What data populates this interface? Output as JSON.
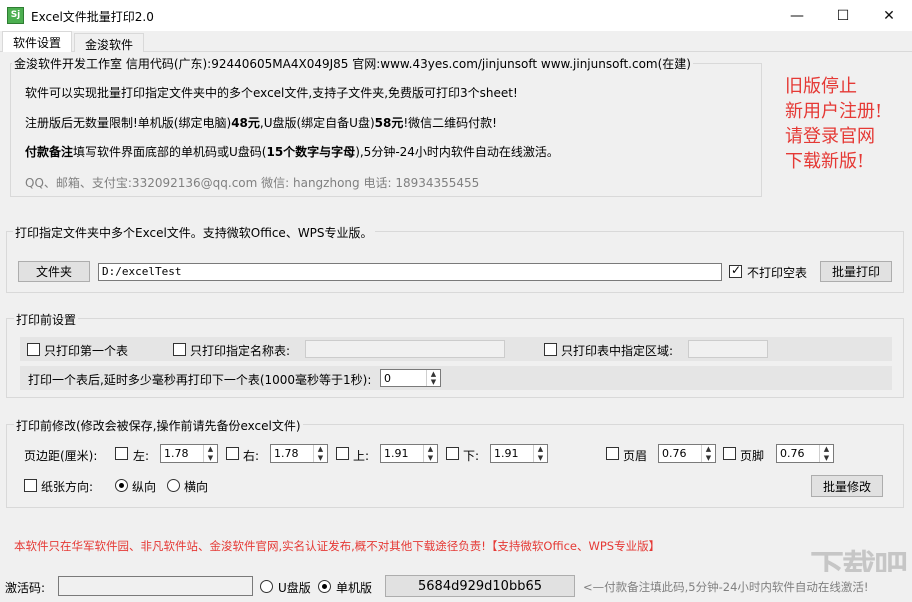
{
  "window": {
    "title": "Excel文件批量打印2.0",
    "icon_text": "Sj",
    "minimize": "—",
    "maximize": "☐",
    "close": "✕"
  },
  "tabs": [
    {
      "label": "软件设置",
      "active": true
    },
    {
      "label": "金浚软件",
      "active": false
    }
  ],
  "info": {
    "company_line": "金浚软件开发工作室 信用代码(广东):92440605MA4X049J85 官网:www.43yes.com/jinjunsoft  www.jinjunsoft.com(在建)",
    "line1": "软件可以实现批量打印指定文件夹中的多个excel文件,支持子文件夹,免费版可打印3个sheet!",
    "line2_a": "注册版后无数量限制!单机版(绑定电脑)",
    "line2_price1": "48元",
    "line2_b": ",U盘版(绑定自备U盘)",
    "line2_price2": "58元",
    "line2_c": "!微信二维码付款!",
    "line3_a": "付款备注",
    "line3_b": "填写软件界面底部的单机码或U盘码(",
    "line3_c": "15个数字与字母",
    "line3_d": "),5分钟-24小时内软件自动在线激活。",
    "contact": "QQ、邮箱、支付宝:332092136@qq.com   微信: hangzhong   电话: 18934355455",
    "promo_lines": [
      "旧版停止",
      "新用户注册!",
      "请登录官网",
      "下载新版!"
    ]
  },
  "print_folder": {
    "group_title": "打印指定文件夹中多个Excel文件。支持微软Office、WPS专业版。",
    "folder_button": "文件夹",
    "path_value": "D:/excelTest",
    "skip_blank_label": "不打印空表",
    "skip_blank_checked": true,
    "batch_print_button": "批量打印"
  },
  "pre_settings": {
    "group_title": "打印前设置",
    "only_first_label": "只打印第一个表",
    "only_named_label": "只打印指定名称表:",
    "only_named_value": "",
    "only_range_label": "只打印表中指定区域:",
    "only_range_value": "",
    "delay_label": "打印一个表后,延时多少毫秒再打印下一个表(1000毫秒等于1秒):",
    "delay_value": "0"
  },
  "modify": {
    "group_title": "打印前修改(修改会被保存,操作前请先备份excel文件)",
    "margin_label": "页边距(厘米):",
    "left_label": "左:",
    "left_value": "1.78",
    "right_label": "右:",
    "right_value": "1.78",
    "top_label": "上:",
    "top_value": "1.91",
    "bottom_label": "下:",
    "bottom_value": "1.91",
    "header_label": "页眉",
    "header_value": "0.76",
    "footer_label": "页脚",
    "footer_value": "0.76",
    "orientation_label": "纸张方向:",
    "portrait_label": "纵向",
    "landscape_label": "横向",
    "portrait_selected": true,
    "batch_modify_button": "批量修改"
  },
  "footer_note": "本软件只在华军软件园、非凡软件站、金浚软件官网,实名认证发布,概不对其他下载途径负责!【支持微软Office、WPS专业版】",
  "status": {
    "activation_label": "激活码:",
    "activation_value": "",
    "usb_label": "U盘版",
    "standalone_label": "单机版",
    "standalone_selected": true,
    "machine_code": "5684d929d10bb65",
    "hint": "<—付款备注填此码,5分钟-24小时内软件自动在线激活!"
  },
  "watermark": "下载吧",
  "colors": {
    "accent_red": "#e53935",
    "window_bg": "#f0f0f0"
  }
}
